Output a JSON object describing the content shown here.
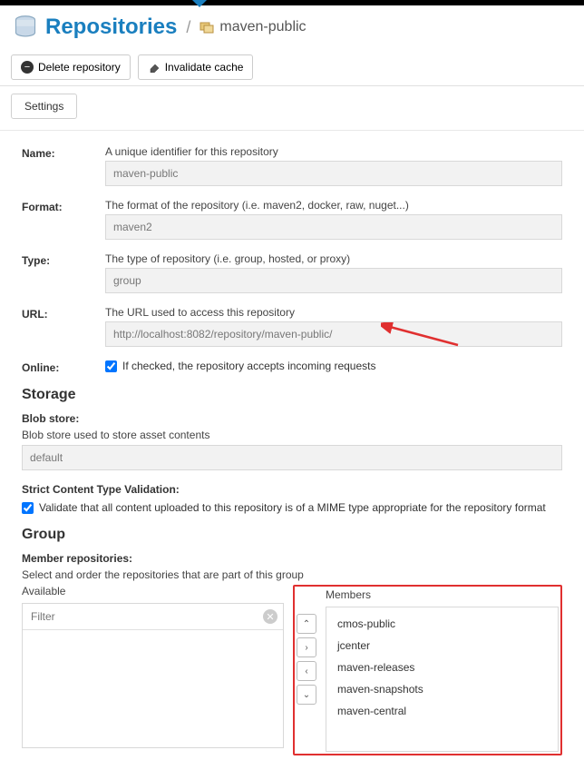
{
  "header": {
    "title": "Repositories",
    "repo_name": "maven-public"
  },
  "toolbar": {
    "delete_label": "Delete repository",
    "invalidate_label": "Invalidate cache"
  },
  "tabs": {
    "settings": "Settings"
  },
  "fields": {
    "name": {
      "label": "Name:",
      "hint": "A unique identifier for this repository",
      "value": "maven-public"
    },
    "format": {
      "label": "Format:",
      "hint": "The format of the repository (i.e. maven2, docker, raw, nuget...)",
      "value": "maven2"
    },
    "type": {
      "label": "Type:",
      "hint": "The type of repository (i.e. group, hosted, or proxy)",
      "value": "group"
    },
    "url": {
      "label": "URL:",
      "hint": "The URL used to access this repository",
      "value": "http://localhost:8082/repository/maven-public/"
    },
    "online": {
      "label": "Online:",
      "checkbox_label": "If checked, the repository accepts incoming requests"
    }
  },
  "storage": {
    "title": "Storage",
    "blob_label": "Blob store:",
    "blob_hint": "Blob store used to store asset contents",
    "blob_value": "default",
    "strict_label": "Strict Content Type Validation:",
    "strict_checkbox": "Validate that all content uploaded to this repository is of a MIME type appropriate for the repository format"
  },
  "group": {
    "title": "Group",
    "member_label": "Member repositories:",
    "member_hint": "Select and order the repositories that are part of this group",
    "available_label": "Available",
    "members_label": "Members",
    "filter_placeholder": "Filter",
    "members": [
      "cmos-public",
      "jcenter",
      "maven-releases",
      "maven-snapshots",
      "maven-central"
    ]
  }
}
